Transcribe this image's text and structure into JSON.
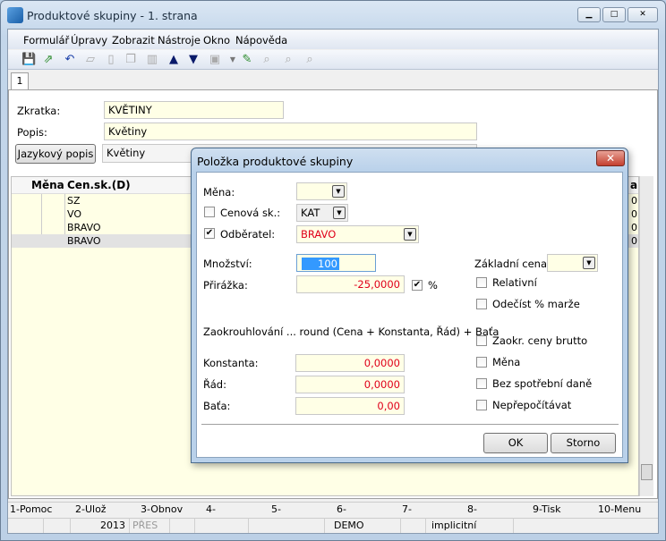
{
  "window": {
    "title": "Produktové skupiny - 1. strana",
    "min": "▁",
    "max": "□",
    "close": "✕"
  },
  "menu": [
    "Formulář",
    "Úpravy",
    "Zobrazit",
    "Nástroje",
    "Okno",
    "Nápověda"
  ],
  "tab": "1",
  "form": {
    "zkratka_label": "Zkratka:",
    "zkratka_value": "KVĚTINY",
    "popis_label": "Popis:",
    "popis_value": "Květiny",
    "jazykovy_button": "Jazykový popis",
    "jazykovy_value": "Květiny"
  },
  "grid": {
    "headers": [
      "Měna",
      "Cen.sk.(D)"
    ],
    "right_header": "a",
    "rows": [
      {
        "cen": "SZ",
        "r": "0"
      },
      {
        "cen": "VO",
        "r": "0"
      },
      {
        "cen": "BRAVO",
        "r": "0"
      },
      {
        "cen": "BRAVO",
        "r": "0"
      }
    ],
    "selected_row": 3
  },
  "dialog": {
    "title": "Položka produktové skupiny",
    "mena_label": "Měna:",
    "mena_value": "",
    "cenova_label": "Cenová sk.:",
    "cenova_checked": false,
    "cenova_value": "KAT",
    "odberatel_label": "Odběratel:",
    "odberatel_checked": true,
    "odberatel_value": "BRAVO",
    "mnozstvi_label": "Množství:",
    "mnozstvi_value": "100",
    "prirazka_label": "Přirážka:",
    "prirazka_value": "-25,0000",
    "percent_checked": true,
    "percent_label": "%",
    "zakladni_label": "Základní cena:",
    "zakladni_value": "",
    "relativni": "Relativní",
    "odecist": "Odečíst % marže",
    "rounding_text": "Zaokrouhlování ... round (Cena + Konstanta, Řád) + Baťa",
    "konstanta_label": "Konstanta:",
    "konstanta_value": "0,0000",
    "rad_label": "Řád:",
    "rad_value": "0,0000",
    "bata_label": "Baťa:",
    "bata_value": "0,00",
    "zaokr": "Zaokr. ceny brutto",
    "mena2": "Měna",
    "bez": "Bez spotřební daně",
    "neprepocitavat": "Nepřepočítávat",
    "ok": "OK",
    "storno": "Storno"
  },
  "fkeys": [
    "1-Pomoc",
    "2-Ulož",
    "3-Obnov",
    "4-",
    "5-",
    "6-",
    "7-",
    "8-",
    "9-Tisk",
    "10-Menu"
  ],
  "status": {
    "year": "2013",
    "mode": "PŘES",
    "db": "DEMO",
    "profile": "implicitní"
  },
  "colors": {
    "accent_red": "#e0001a",
    "field_bg": "#ffffe6",
    "selection": "#3399ff"
  }
}
